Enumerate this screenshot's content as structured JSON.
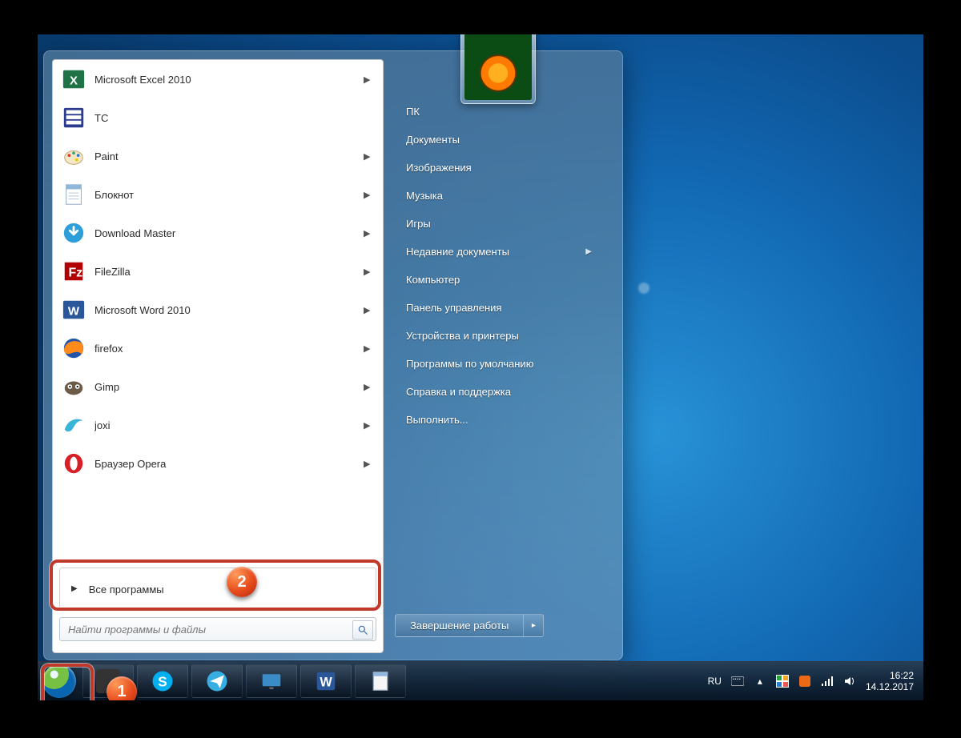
{
  "left_panel": {
    "programs": [
      {
        "label": "Microsoft Excel 2010",
        "icon": "excel-icon",
        "has_submenu": true
      },
      {
        "label": "TC",
        "icon": "tc-icon",
        "has_submenu": false
      },
      {
        "label": "Paint",
        "icon": "paint-icon",
        "has_submenu": true
      },
      {
        "label": "Блокнот",
        "icon": "notepad-icon",
        "has_submenu": true
      },
      {
        "label": "Download Master",
        "icon": "dm-icon",
        "has_submenu": true
      },
      {
        "label": "FileZilla",
        "icon": "filezilla-icon",
        "has_submenu": true
      },
      {
        "label": "Microsoft Word 2010",
        "icon": "word-icon",
        "has_submenu": true
      },
      {
        "label": "firefox",
        "icon": "firefox-icon",
        "has_submenu": true
      },
      {
        "label": "Gimp",
        "icon": "gimp-icon",
        "has_submenu": true
      },
      {
        "label": "joxi",
        "icon": "joxi-icon",
        "has_submenu": true
      },
      {
        "label": "Браузер Opera",
        "icon": "opera-icon",
        "has_submenu": true
      }
    ],
    "all_programs_label": "Все программы",
    "search_placeholder": "Найти программы и файлы"
  },
  "right_panel": {
    "items": [
      {
        "label": "ПК",
        "has_submenu": false
      },
      {
        "label": "Документы",
        "has_submenu": false
      },
      {
        "label": "Изображения",
        "has_submenu": false
      },
      {
        "label": "Музыка",
        "has_submenu": false
      },
      {
        "label": "Игры",
        "has_submenu": false
      },
      {
        "label": "Недавние документы",
        "has_submenu": true
      },
      {
        "label": "Компьютер",
        "has_submenu": false
      },
      {
        "label": "Панель управления",
        "has_submenu": false
      },
      {
        "label": "Устройства и принтеры",
        "has_submenu": false
      },
      {
        "label": "Программы по умолчанию",
        "has_submenu": false
      },
      {
        "label": "Справка и поддержка",
        "has_submenu": false
      },
      {
        "label": "Выполнить...",
        "has_submenu": false
      }
    ],
    "shutdown_label": "Завершение работы"
  },
  "systray": {
    "language": "RU",
    "time": "16:22",
    "date": "14.12.2017"
  },
  "callouts": {
    "one": "1",
    "two": "2"
  }
}
